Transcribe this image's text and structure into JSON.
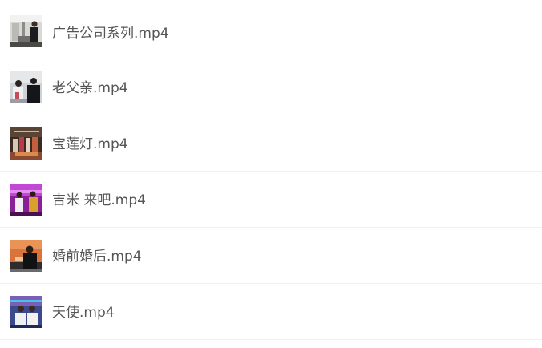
{
  "files": [
    {
      "name": "广告公司系列.mp4",
      "thumbnail": "video-thumbnail-icon"
    },
    {
      "name": "老父亲.mp4",
      "thumbnail": "video-thumbnail-icon"
    },
    {
      "name": "宝莲灯.mp4",
      "thumbnail": "video-thumbnail-icon"
    },
    {
      "name": "吉米 来吧.mp4",
      "thumbnail": "video-thumbnail-icon"
    },
    {
      "name": "婚前婚后.mp4",
      "thumbnail": "video-thumbnail-icon"
    },
    {
      "name": "天使.mp4",
      "thumbnail": "video-thumbnail-icon"
    }
  ],
  "colors": {
    "text": "#555555",
    "divider": "#f1f1f1",
    "background": "#ffffff"
  }
}
